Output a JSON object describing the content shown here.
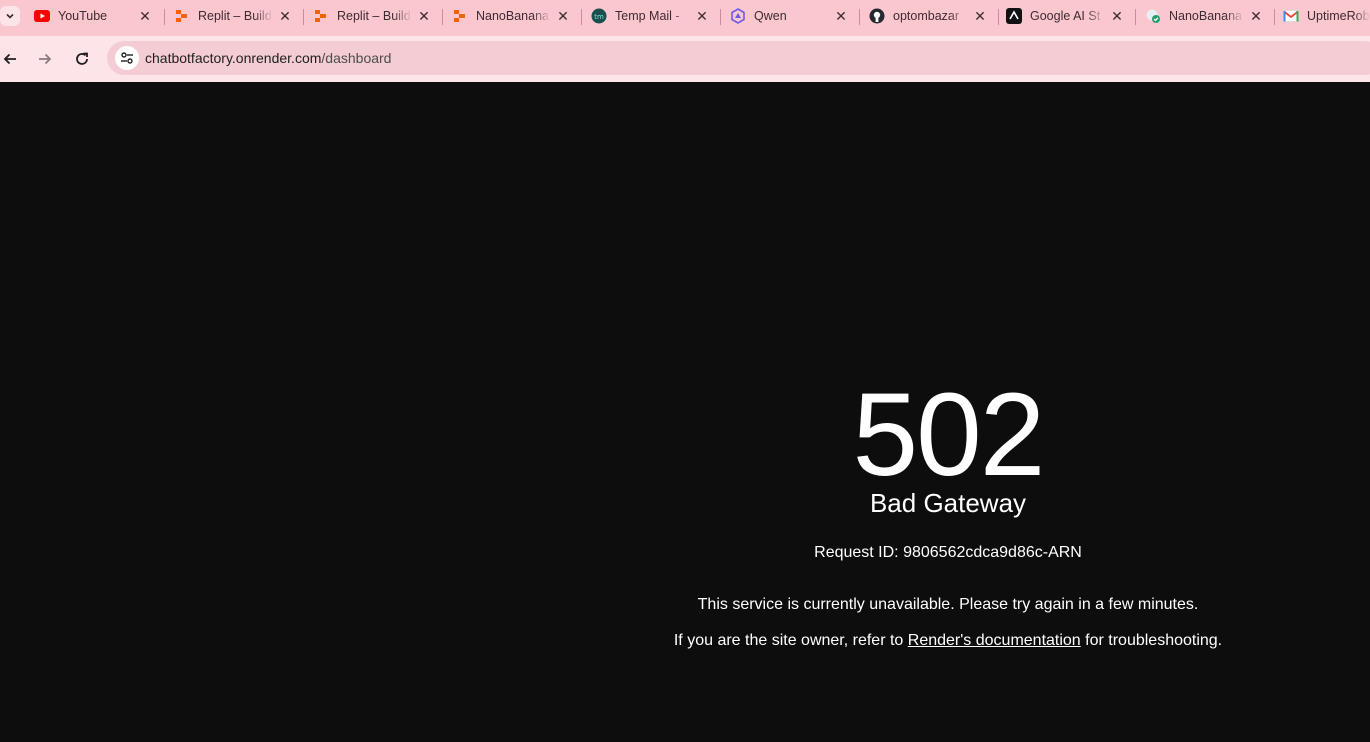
{
  "browser": {
    "tabs": [
      {
        "title": "YouTube",
        "icon": "youtube-icon"
      },
      {
        "title": "Replit – Build",
        "icon": "replit-icon"
      },
      {
        "title": "Replit – Build",
        "icon": "replit-icon"
      },
      {
        "title": "NanoBanana",
        "icon": "replit-icon"
      },
      {
        "title": "Temp Mail - ",
        "icon": "tempmail-icon"
      },
      {
        "title": "Qwen",
        "icon": "qwen-icon"
      },
      {
        "title": "optombazar",
        "icon": "github-icon"
      },
      {
        "title": "Google AI St",
        "icon": "google-ai-studio-icon"
      },
      {
        "title": "NanoBanana",
        "icon": "nanobanana-icon"
      },
      {
        "title": "UptimeRobot",
        "icon": "gmail-icon"
      }
    ],
    "url_host": "chatbotfactory.onrender.com",
    "url_path": "/dashboard"
  },
  "error": {
    "code": "502",
    "message": "Bad Gateway",
    "request_id": "Request ID: 9806562cdca9d86c-ARN",
    "unavailable": "This service is currently unavailable. Please try again in a few minutes.",
    "owner_prefix": "If you are the site owner, refer to ",
    "docs_link": "Render's documentation",
    "owner_suffix": " for troubleshooting."
  },
  "colors": {
    "chrome_bg": "#fbc7cf",
    "toolbar_bg": "#fde4e8",
    "page_bg": "#0d0d0e",
    "text": "#ffffff"
  }
}
